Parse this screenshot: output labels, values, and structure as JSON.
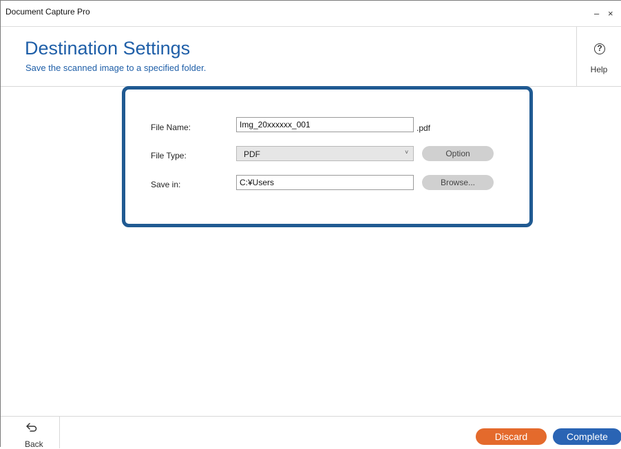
{
  "window": {
    "title": "Document Capture Pro",
    "minimize_label": "–",
    "close_label": "×"
  },
  "header": {
    "title": "Destination Settings",
    "subtitle": "Save the scanned image to a specified folder.",
    "help_label": "Help",
    "help_icon": "question-circle-icon",
    "help_glyph": "?"
  },
  "settings": {
    "file_name": {
      "label": "File Name:",
      "value": "Img_20xxxxxx_001",
      "extension": ".pdf"
    },
    "file_type": {
      "label": "File Type:",
      "selected": "PDF",
      "arrow": "˅",
      "option_button": "Option"
    },
    "save_in": {
      "label": "Save in:",
      "value": "C:¥Users",
      "browse_button": "Browse..."
    }
  },
  "footer": {
    "back_label": "Back",
    "back_icon": "back-arrow-icon",
    "discard_label": "Discard",
    "complete_label": "Complete"
  },
  "colors": {
    "accent": "#1f5fa8",
    "box_border": "#205a92",
    "discard": "#e46a2c",
    "complete": "#2a64b4",
    "pill_gray": "#d0d0d0"
  }
}
